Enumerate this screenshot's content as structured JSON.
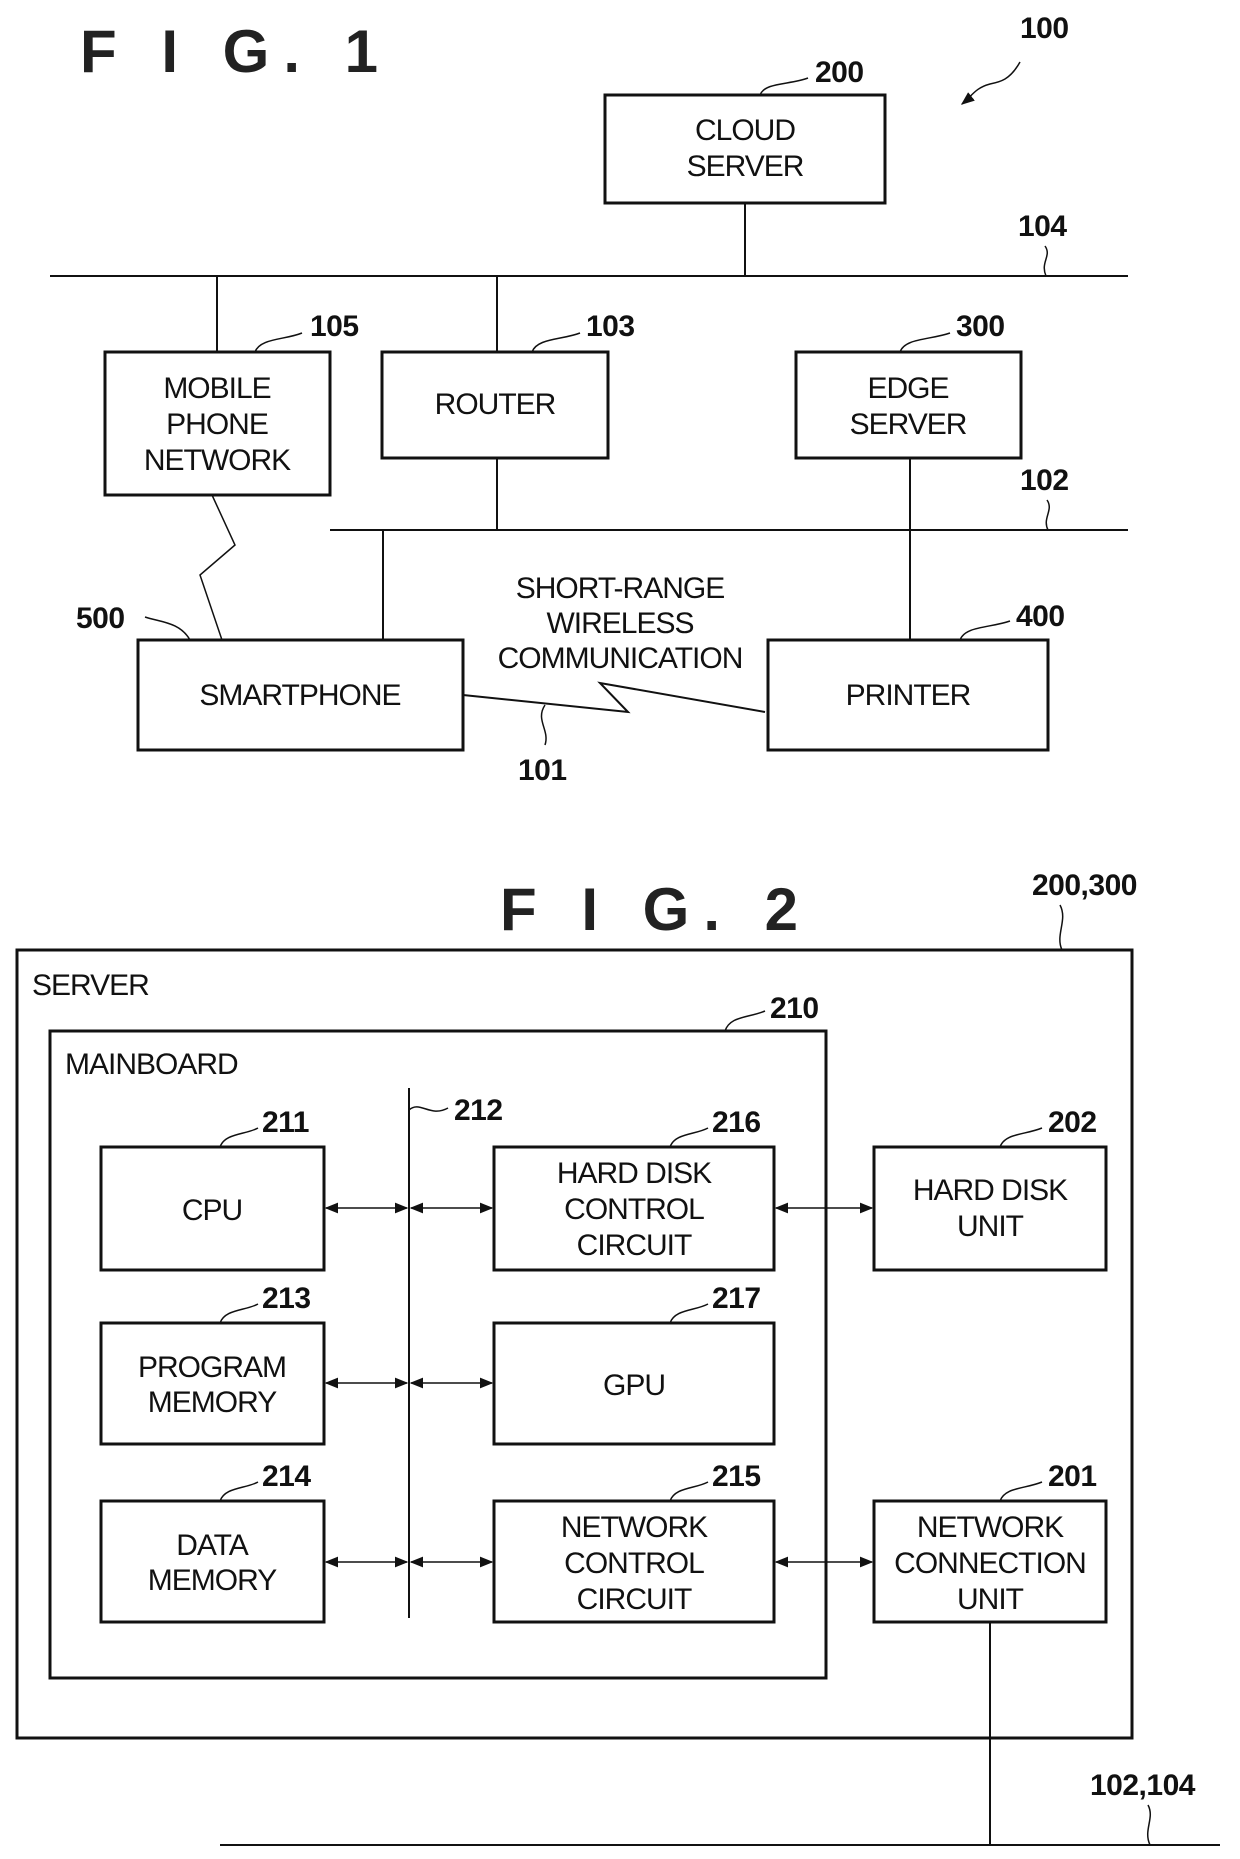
{
  "fig1": {
    "title": "F I G. 1",
    "system_ref": "100",
    "networks": {
      "wan": {
        "ref": "104"
      },
      "lan": {
        "ref": "102"
      },
      "short_range": {
        "ref": "101",
        "label_lines": [
          "SHORT-RANGE",
          "WIRELESS",
          "COMMUNICATION"
        ]
      }
    },
    "nodes": [
      {
        "id": "cloud",
        "ref": "200",
        "lines": [
          "CLOUD",
          "SERVER"
        ]
      },
      {
        "id": "mobile",
        "ref": "105",
        "lines": [
          "MOBILE",
          "PHONE",
          "NETWORK"
        ]
      },
      {
        "id": "router",
        "ref": "103",
        "lines": [
          "ROUTER"
        ]
      },
      {
        "id": "edge",
        "ref": "300",
        "lines": [
          "EDGE",
          "SERVER"
        ]
      },
      {
        "id": "smartphone",
        "ref": "500",
        "lines": [
          "SMARTPHONE"
        ]
      },
      {
        "id": "printer",
        "ref": "400",
        "lines": [
          "PRINTER"
        ]
      }
    ]
  },
  "fig2": {
    "title": "F I G. 2",
    "server": {
      "label": "SERVER",
      "ref": "200,300"
    },
    "mainboard": {
      "label": "MAINBOARD",
      "ref": "210"
    },
    "bus": {
      "ref": "212"
    },
    "network_ref": "102,104",
    "nodes": [
      {
        "id": "cpu",
        "ref": "211",
        "lines": [
          "CPU"
        ]
      },
      {
        "id": "program_memory",
        "ref": "213",
        "lines": [
          "PROGRAM",
          "MEMORY"
        ]
      },
      {
        "id": "data_memory",
        "ref": "214",
        "lines": [
          "DATA",
          "MEMORY"
        ]
      },
      {
        "id": "hdd_ctrl",
        "ref": "216",
        "lines": [
          "HARD DISK",
          "CONTROL",
          "CIRCUIT"
        ]
      },
      {
        "id": "gpu",
        "ref": "217",
        "lines": [
          "GPU"
        ]
      },
      {
        "id": "net_ctrl",
        "ref": "215",
        "lines": [
          "NETWORK",
          "CONTROL",
          "CIRCUIT"
        ]
      },
      {
        "id": "hdd_unit",
        "ref": "202",
        "lines": [
          "HARD DISK",
          "UNIT"
        ]
      },
      {
        "id": "net_conn",
        "ref": "201",
        "lines": [
          "NETWORK",
          "CONNECTION",
          "UNIT"
        ]
      }
    ]
  }
}
